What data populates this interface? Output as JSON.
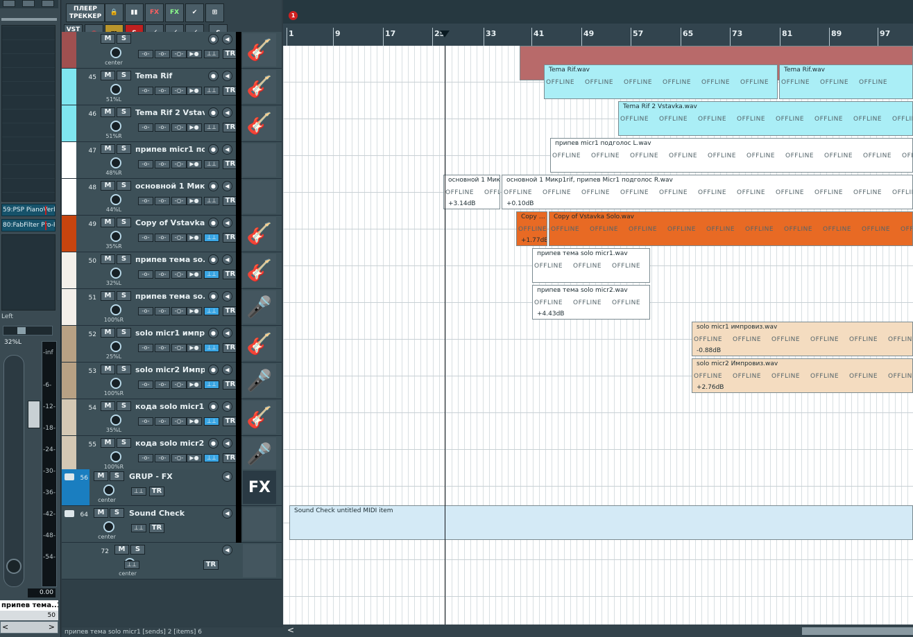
{
  "mixer": {
    "fx_slots": [
      "59:PSP PianoVerb",
      "80:FabFilter Pro-R"
    ],
    "pan_label": "Left",
    "pan_value": "32%L",
    "meter_labels": [
      "-inf",
      "-6-",
      "-12-",
      "-18-",
      "-24-",
      "-30-",
      "-36-",
      "-42-",
      "-48-",
      "-54-"
    ],
    "volume": "0.00",
    "track_name": "припев тема..1",
    "track_num": "50"
  },
  "toolbar": {
    "player_tracker": "ПЛЕЕР ТРЕККЕР",
    "vst": "VST VSTi",
    "fx1": "FX",
    "fx2": "FX",
    "m": "m",
    "s": "S"
  },
  "tracks": [
    {
      "num": "",
      "name": "",
      "pan": "center",
      "color": "#a05050",
      "thumb": "🎸"
    },
    {
      "num": "45",
      "name": "Tema Rif",
      "pan": "51%L",
      "color": "#7fe6f0",
      "thumb": "🎸"
    },
    {
      "num": "46",
      "name": "Tema Rif 2 Vstavka",
      "pan": "51%R",
      "color": "#7fe6f0",
      "thumb": "🎸"
    },
    {
      "num": "47",
      "name": "припев micr1 под",
      "pan": "48%R",
      "color": "#ffffff",
      "thumb": ""
    },
    {
      "num": "48",
      "name": "основной 1 Микр:",
      "pan": "44%L",
      "color": "#ffffff",
      "thumb": ""
    },
    {
      "num": "49",
      "name": "Copy of  Vstavka Sc",
      "pan": "35%R",
      "color": "#c8440e",
      "thumb": "🎸"
    },
    {
      "num": "50",
      "name": "припев тема so..1",
      "pan": "32%L",
      "color": "#f4f0ea",
      "thumb": "🎸"
    },
    {
      "num": "51",
      "name": "припев тема so..2",
      "pan": "100%R",
      "color": "#f4f0ea",
      "thumb": "🎤"
    },
    {
      "num": "52",
      "name": "solo micr1 импро:",
      "pan": "25%L",
      "color": "#b8a184",
      "thumb": "🎸"
    },
    {
      "num": "53",
      "name": "solo micr2 Импро:",
      "pan": "100%R",
      "color": "#b8a184",
      "thumb": "🎤"
    },
    {
      "num": "54",
      "name": "кода solo micr1 ии",
      "pan": "35%L",
      "color": "#d4c8b4",
      "thumb": "🎸"
    },
    {
      "num": "55",
      "name": "кода  solo micr2 И",
      "pan": "100%R",
      "color": "#d4c8b4",
      "thumb": "🎤"
    }
  ],
  "folders": [
    {
      "num": "56",
      "name": "GRUP - FX",
      "pan": "center",
      "thumb": "FX"
    },
    {
      "num": "64",
      "name": "Sound Check",
      "pan": "center",
      "thumb": ""
    },
    {
      "num": "72",
      "name": "",
      "pan": "center",
      "thumb": ""
    }
  ],
  "ruler": {
    "marker": "1",
    "bars": [
      "1",
      "9",
      "17",
      "25",
      "33",
      "41",
      "49",
      "57",
      "65",
      "73",
      "81",
      "89",
      "97"
    ]
  },
  "items": {
    "offline": "OFFLINE",
    "tema_rif_a": "Tema Rif.wav",
    "tema_rif_b": "Tema Rif.wav",
    "tema_rif2": "Tema Rif 2 Vstavka.wav",
    "pripev_l": "припев micr1 подголос L.wav",
    "osnovnoy_a": "основной 1 Мик…",
    "osnovnoy_b": "основной 1 Микр1rif, припев Micr1 подголос R.wav",
    "osnovnoy_gain_a": "+3.14dB",
    "osnovnoy_gain_b": "+0.10dB",
    "copy_a": "Copy …",
    "copy_b": "Copy of  Vstavka Solo.wav",
    "copy_gain": "+1.77dB",
    "pripev_solo1": "припев тема solo micr1.wav",
    "pripev_solo2": "припев тема solo micr2.wav",
    "pripev_solo2_gain": "+4.43dB",
    "solo1": "solo micr1 импровиз.wav",
    "solo1_gain": "-0.88dB",
    "solo2": "solo micr2 Импровиз.wav",
    "solo2_gain": "+2.76dB",
    "midi": "Sound Check untitled MIDI item"
  },
  "status": "припев тема solo micr1 [sends] 2 [items] 6"
}
